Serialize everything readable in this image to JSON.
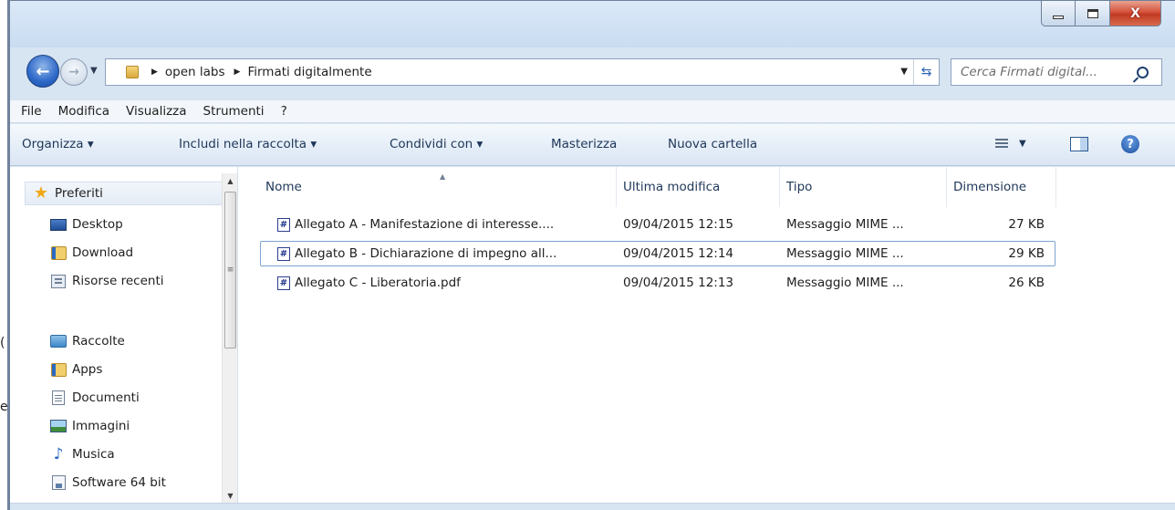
{
  "window": {
    "close_glyph": "X"
  },
  "outside": {
    "fragment_1": "e",
    "fragment_2": "(",
    "fragment_3": "("
  },
  "nav": {
    "address_crumbs": [
      "open labs",
      "Firmati digitalmente"
    ],
    "search_placeholder": "Cerca Firmati digital..."
  },
  "menu": {
    "items": [
      "File",
      "Modifica",
      "Visualizza",
      "Strumenti",
      "?"
    ]
  },
  "commands": {
    "organize": "Organizza ▾",
    "include": "Includi nella raccolta ▾",
    "share": "Condividi con ▾",
    "burn": "Masterizza",
    "new_folder": "Nuova cartella",
    "help": "?"
  },
  "sidebar": {
    "favorites_label": "Preferiti",
    "favorites": [
      "Desktop",
      "Download",
      "Risorse recenti"
    ],
    "libraries_label": "Raccolte",
    "libraries": [
      "Apps",
      "Documenti",
      "Immagini",
      "Musica",
      "Software 64 bit"
    ]
  },
  "files": {
    "columns": [
      "Nome",
      "Ultima modifica",
      "Tipo",
      "Dimensione"
    ],
    "rows": [
      {
        "name": "Allegato A - Manifestazione di interesse....",
        "modified": "09/04/2015 12:15",
        "type": "Messaggio MIME ...",
        "size": "27 KB"
      },
      {
        "name": "Allegato B - Dichiarazione di impegno all...",
        "modified": "09/04/2015 12:14",
        "type": "Messaggio MIME ...",
        "size": "29 KB"
      },
      {
        "name": "Allegato C - Liberatoria.pdf",
        "modified": "09/04/2015 12:13",
        "type": "Messaggio MIME ...",
        "size": "26 KB"
      }
    ],
    "selected_index": 1
  },
  "colors": {
    "window_frame": "#d7e4f2",
    "selection_border": "#7da2ce",
    "accent": "#2e68c8"
  }
}
